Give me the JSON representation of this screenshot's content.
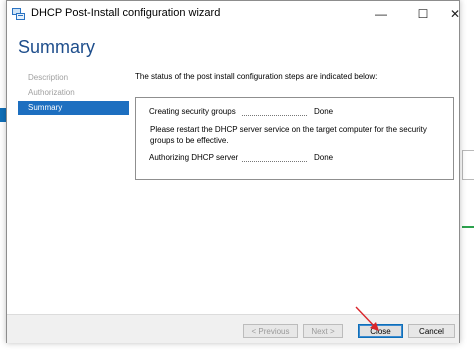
{
  "window": {
    "title": "DHCP Post-Install configuration wizard",
    "min_symbol": "—",
    "max_symbol": "☐",
    "close_symbol": "✕"
  },
  "header": {
    "title": "Summary"
  },
  "nav": {
    "items": [
      {
        "label": "Description",
        "active": false
      },
      {
        "label": "Authorization",
        "active": false
      },
      {
        "label": "Summary",
        "active": true
      }
    ]
  },
  "content": {
    "intro": "The status of the post install configuration steps are indicated below:",
    "steps": [
      {
        "label": "Creating security groups",
        "status": "Done"
      },
      {
        "label": "Authorizing DHCP server",
        "status": "Done"
      }
    ],
    "note": "Please restart the DHCP server service on the target computer for the security groups to be effective."
  },
  "footer": {
    "previous_label": "< Previous",
    "next_label": "Next >",
    "close_label": "Close",
    "cancel_label": "Cancel"
  },
  "colors": {
    "accent": "#1d6fc0",
    "title_blue": "#1e4e8c",
    "arrow_red": "#d9262b"
  },
  "icons": {
    "app": "dhcp-server-icon",
    "annotation": "red-pointer-arrow"
  }
}
